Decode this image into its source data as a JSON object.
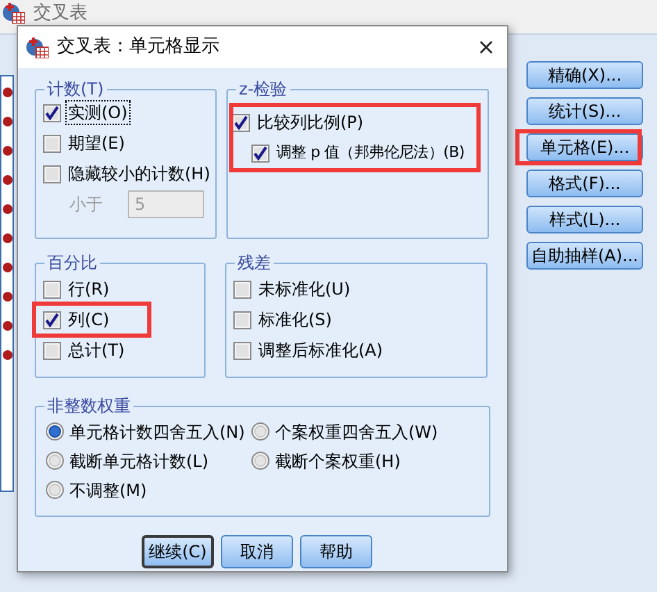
{
  "background_window": {
    "title": "交叉表",
    "buttons": [
      {
        "label": "精确(X)...",
        "highlighted": false
      },
      {
        "label": "统计(S)...",
        "highlighted": false
      },
      {
        "label": "单元格(E)...",
        "highlighted": true
      },
      {
        "label": "格式(F)...",
        "highlighted": false
      },
      {
        "label": "样式(L)...",
        "highlighted": false
      },
      {
        "label": "自助抽样(A)...",
        "highlighted": false
      }
    ]
  },
  "dialog": {
    "title": "交叉表：单元格显示",
    "counts": {
      "legend": "计数(T)",
      "items": [
        {
          "label": "实测(O)",
          "checked": true,
          "focused": true
        },
        {
          "label": "期望(E)",
          "checked": false,
          "focused": false
        },
        {
          "label": "隐藏较小的计数(H)",
          "checked": false,
          "focused": false
        }
      ],
      "threshold": {
        "label": "小于",
        "value": "5",
        "disabled": true
      }
    },
    "z_test": {
      "legend": "z-检验",
      "highlighted": true,
      "items": [
        {
          "label": "比较列比例(P)",
          "checked": true,
          "children": [
            {
              "label": "调整 p 值（邦弗伦尼法）(B)",
              "checked": true
            }
          ]
        }
      ]
    },
    "percentages": {
      "legend": "百分比",
      "items": [
        {
          "label": "行(R)",
          "checked": false,
          "highlighted": false
        },
        {
          "label": "列(C)",
          "checked": true,
          "highlighted": true
        },
        {
          "label": "总计(T)",
          "checked": false,
          "highlighted": false
        }
      ]
    },
    "residuals": {
      "legend": "残差",
      "items": [
        {
          "label": "未标准化(U)",
          "checked": false
        },
        {
          "label": "标准化(S)",
          "checked": false
        },
        {
          "label": "调整后标准化(A)",
          "checked": false
        }
      ]
    },
    "noninteger_weights": {
      "legend": "非整数权重",
      "options": [
        {
          "label": "单元格计数四舍五入(N)",
          "selected": true
        },
        {
          "label": "个案权重四舍五入(W)",
          "selected": false
        },
        {
          "label": "截断单元格计数(L)",
          "selected": false
        },
        {
          "label": "截断个案权重(H)",
          "selected": false
        },
        {
          "label": "不调整(M)",
          "selected": false
        }
      ]
    },
    "buttons": [
      {
        "label": "继续(C)",
        "default": true
      },
      {
        "label": "取消",
        "default": false
      },
      {
        "label": "帮助",
        "default": false
      }
    ]
  }
}
